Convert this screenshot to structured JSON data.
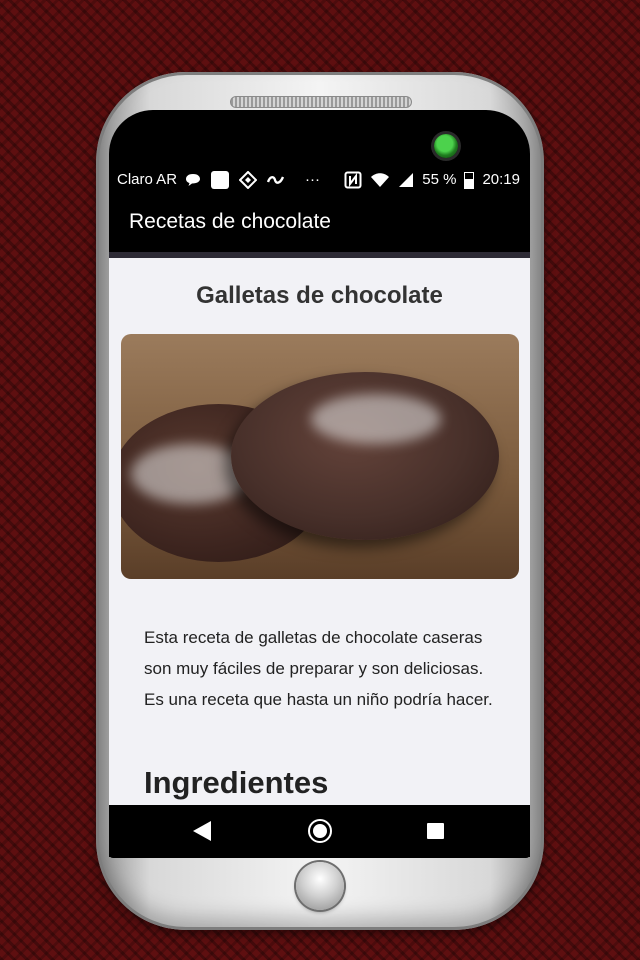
{
  "status_bar": {
    "carrier": "Claro AR",
    "icons": [
      "chat-bubble-icon",
      "app-square-icon",
      "diamond-logo-icon",
      "swirl-icon",
      "more-dots-icon",
      "nfc-icon",
      "wifi-icon",
      "signal-icon",
      "battery-icon"
    ],
    "more": "···",
    "battery_percent": "55 %",
    "time": "20:19"
  },
  "app_bar": {
    "title": "Recetas de chocolate"
  },
  "recipe": {
    "title": "Galletas de chocolate",
    "image": "chocolate-cookies-photo",
    "description": "Esta receta de galletas de chocolate caseras son muy fáciles de preparar y son deliciosas. Es una receta que hasta un niño podría hacer.",
    "section_heading": "Ingredientes"
  },
  "nav_bar": {
    "buttons": [
      "back-icon",
      "home-icon",
      "recent-apps-icon"
    ]
  },
  "colors": {
    "background": "#5e0f10",
    "app_bar": "#000000",
    "content_bg": "#f2f2f6"
  }
}
